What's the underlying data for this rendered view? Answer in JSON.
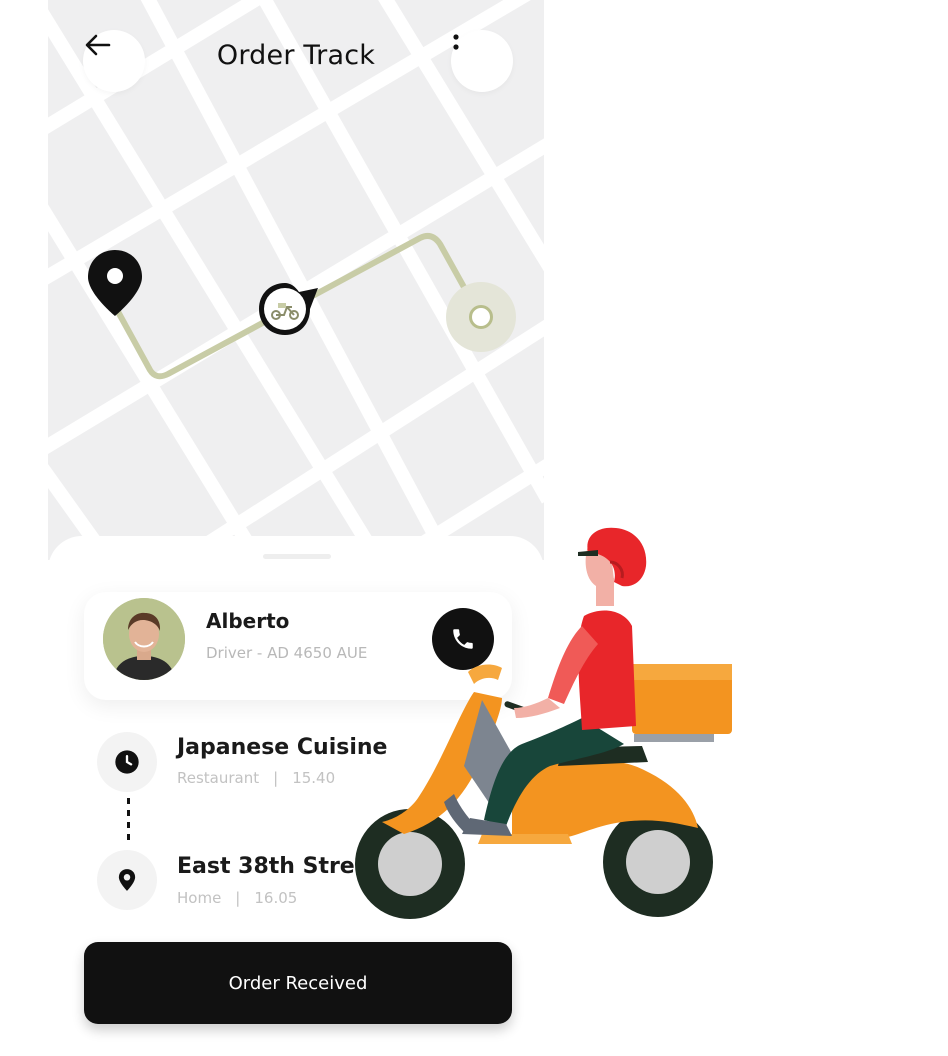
{
  "header": {
    "title": "Order Track",
    "back_icon": "arrow-left-icon",
    "menu_icon": "more-vertical-icon"
  },
  "map": {
    "route_color": "#c8cca6",
    "origin_icon": "map-pin-icon",
    "vehicle_icon": "scooter-icon",
    "destination_icon": "destination-dot-icon"
  },
  "driver": {
    "name": "Alberto",
    "info": "Driver - AD 4650 AUE",
    "call_icon": "phone-icon"
  },
  "stops": [
    {
      "name": "Japanese Cuisine",
      "type": "Restaurant",
      "time": "15.40",
      "icon": "clock-icon"
    },
    {
      "name": "East 38th Stree",
      "type": "Home",
      "time": "16.05",
      "icon": "location-pin-icon"
    }
  ],
  "separator": "|",
  "action": {
    "label": "Order Received"
  },
  "colors": {
    "accent": "#111111",
    "rider_helmet": "#e8262a",
    "scooter": "#f59a23"
  }
}
